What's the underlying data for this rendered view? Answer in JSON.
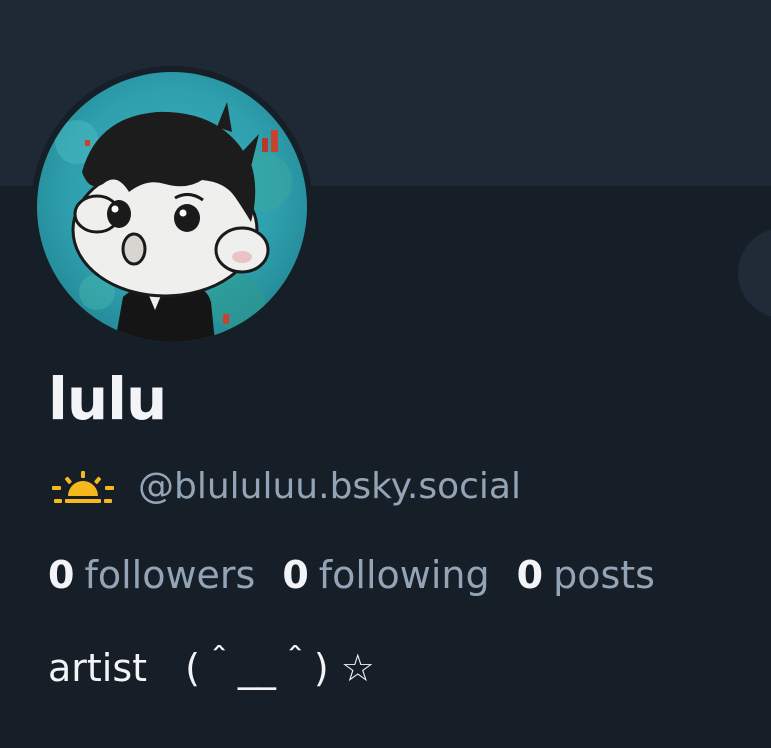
{
  "profile": {
    "display_name": "lulu",
    "handle_icon": "sunrise-icon",
    "handle": "@blululuu.bsky.social",
    "bio": "artist　(＾__＾) ☆"
  },
  "stats": {
    "followers_count": "0",
    "followers_label": "followers",
    "following_count": "0",
    "following_label": "following",
    "posts_count": "0",
    "posts_label": "posts"
  },
  "colors": {
    "background": "#161e27",
    "banner": "#1e2935",
    "text_primary": "#f2f4f7",
    "text_secondary": "#93a4b6",
    "sun_accent": "#f5b91e"
  }
}
